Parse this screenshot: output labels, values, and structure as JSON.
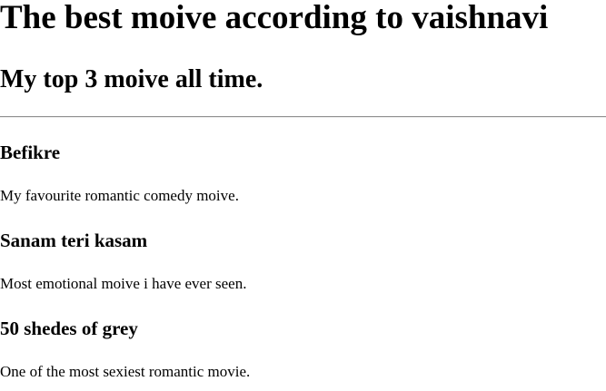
{
  "page": {
    "heading": "The best moive according to vaishnavi",
    "subheading": "My top 3 moive all time."
  },
  "movies": [
    {
      "title": "Befikre",
      "description": "My favourite romantic comedy moive."
    },
    {
      "title": "Sanam teri kasam",
      "description": "Most emotional moive i have ever seen."
    },
    {
      "title": "50 shedes of grey",
      "description": "One of the most sexiest romantic movie."
    }
  ],
  "colors": {
    "background": "#ffffff",
    "text": "#000000",
    "rule": "#8f8f8f"
  }
}
